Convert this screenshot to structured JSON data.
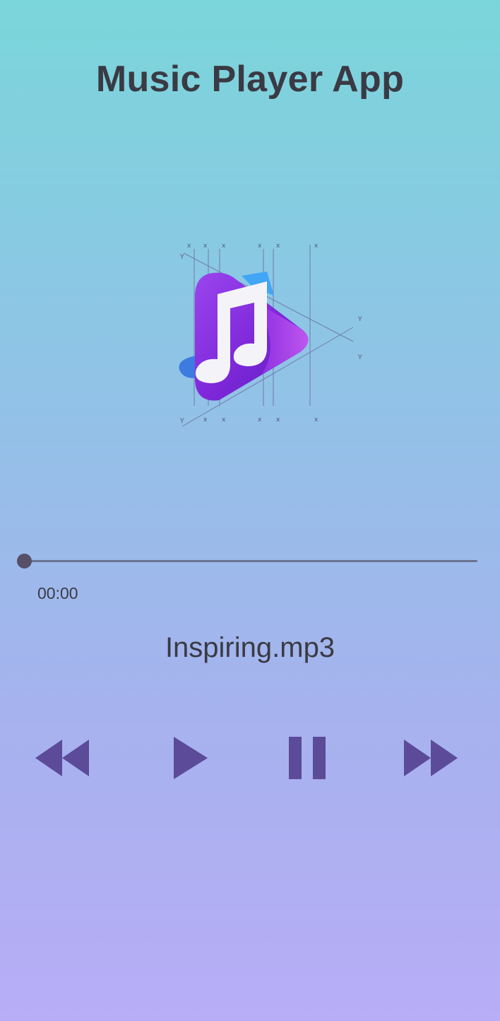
{
  "app": {
    "title": "Music Player App"
  },
  "player": {
    "current_time": "00:00",
    "track_name": "Inspiring.mp3",
    "progress": 0.0
  },
  "controls": [
    {
      "name": "rewind-button",
      "icon": "rewind-icon"
    },
    {
      "name": "play-button",
      "icon": "play-icon"
    },
    {
      "name": "pause-button",
      "icon": "pause-icon"
    },
    {
      "name": "fast-forward-button",
      "icon": "fast-forward-icon"
    }
  ],
  "colors": {
    "gradient_top": "#7ad6da",
    "gradient_bottom": "#b8adf7",
    "text": "#3a3a44",
    "control": "#5b4b99",
    "logo_purple": "#8a2be2",
    "logo_blue": "#42a5f5"
  },
  "artwork": {
    "icon": "music-note-play-logo"
  }
}
